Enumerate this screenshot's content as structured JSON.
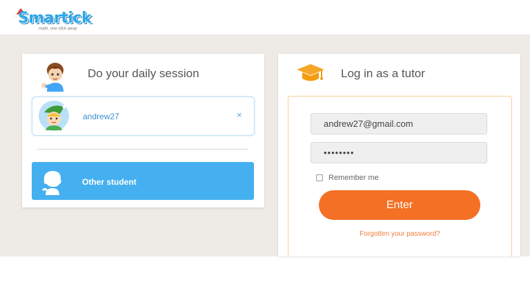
{
  "logo": {
    "name": "Smartick",
    "tagline": "math, one click away"
  },
  "daily_session": {
    "title": "Do your daily session",
    "student": {
      "username": "andrew27",
      "remove_icon": "×"
    },
    "other_student_label": "Other student"
  },
  "tutor_login": {
    "title": "Log in as a tutor",
    "email": {
      "value": "andrew27@gmail.com"
    },
    "password": {
      "value": "••••••••"
    },
    "remember_label": "Remember me",
    "enter_label": "Enter",
    "forgot_label": "Forgotten your password?"
  },
  "colors": {
    "accent_blue": "#45b0ef",
    "accent_orange": "#f37024",
    "background": "#eeebe6"
  }
}
